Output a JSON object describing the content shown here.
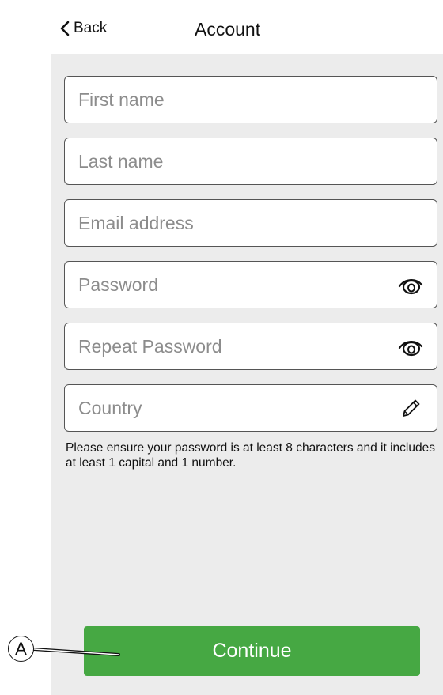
{
  "header": {
    "back_label": "Back",
    "title": "Account"
  },
  "form": {
    "first_name": {
      "placeholder": "First name",
      "value": ""
    },
    "last_name": {
      "placeholder": "Last name",
      "value": ""
    },
    "email": {
      "placeholder": "Email address",
      "value": ""
    },
    "password": {
      "placeholder": "Password",
      "value": "",
      "icon": "eye-icon"
    },
    "repeat_password": {
      "placeholder": "Repeat Password",
      "value": "",
      "icon": "eye-icon"
    },
    "country": {
      "placeholder": "Country",
      "value": "",
      "icon": "pencil-icon"
    },
    "hint": "Please ensure your password is at least 8 characters and it includes at least 1 capital and 1 number."
  },
  "continue_label": "Continue",
  "callout": {
    "label": "A"
  },
  "colors": {
    "primary_button": "#46a843",
    "background": "#ececec",
    "header": "#ffffff"
  }
}
